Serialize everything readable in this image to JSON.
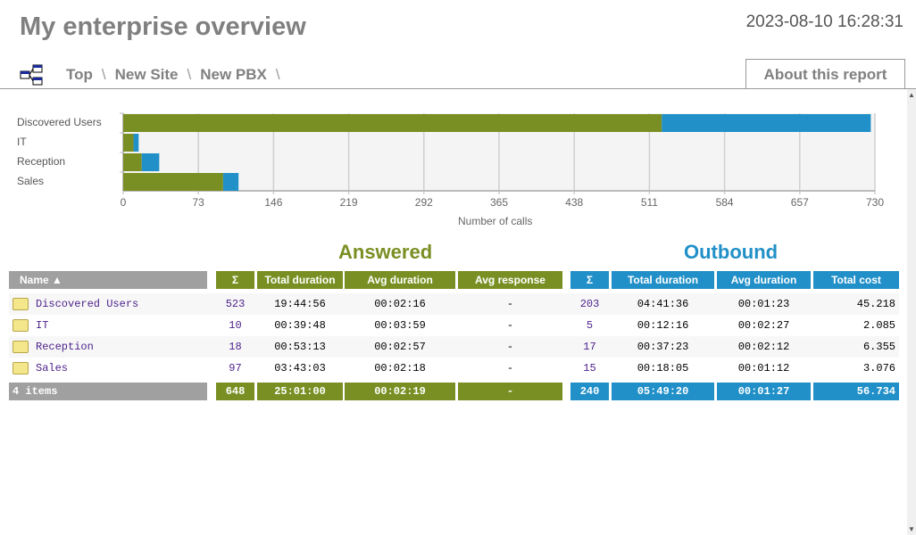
{
  "header": {
    "title": "My enterprise overview",
    "datetime": "2023-08-10 16:28:31",
    "about_label": "About this report"
  },
  "breadcrumb": [
    {
      "label": "Top"
    },
    {
      "label": "New Site"
    },
    {
      "label": "New PBX"
    }
  ],
  "colors": {
    "answered": "#7a8f23",
    "outbound": "#2190c8",
    "name_header": "#a0a0a0",
    "link": "#4b1f8a"
  },
  "chart_data": {
    "type": "bar",
    "orientation": "horizontal",
    "stacked": true,
    "categories": [
      "Discovered Users",
      "IT",
      "Reception",
      "Sales"
    ],
    "series": [
      {
        "values": [
          523,
          10,
          18,
          97
        ],
        "color": "#7a8f23"
      },
      {
        "values": [
          203,
          5,
          17,
          15
        ],
        "color": "#2190c8"
      }
    ],
    "xlabel": "Number of calls",
    "xlim": [
      0,
      730
    ],
    "xticks": [
      "0",
      "73",
      "146",
      "219",
      "292",
      "365",
      "438",
      "511",
      "584",
      "657",
      "730"
    ],
    "grid": true
  },
  "table": {
    "answered_title": "Answered",
    "outbound_title": "Outbound",
    "headers": [
      "Name ▲",
      "Σ",
      "Total duration",
      "Avg duration",
      "Avg response",
      "Σ",
      "Total duration",
      "Avg duration",
      "Total cost"
    ],
    "rows": [
      [
        "Discovered Users",
        "523",
        "19:44:56",
        "00:02:16",
        "-",
        "203",
        "04:41:36",
        "00:01:23",
        "45.218"
      ],
      [
        "IT",
        "10",
        "00:39:48",
        "00:03:59",
        "-",
        "5",
        "00:12:16",
        "00:02:27",
        "2.085"
      ],
      [
        "Reception",
        "18",
        "00:53:13",
        "00:02:57",
        "-",
        "17",
        "00:37:23",
        "00:02:12",
        "6.355"
      ],
      [
        "Sales",
        "97",
        "03:43:03",
        "00:02:18",
        "-",
        "15",
        "00:18:05",
        "00:01:12",
        "3.076"
      ]
    ],
    "footer": [
      "4 items",
      "648",
      "25:01:00",
      "00:02:19",
      "-",
      "240",
      "05:49:20",
      "00:01:27",
      "56.734"
    ]
  }
}
